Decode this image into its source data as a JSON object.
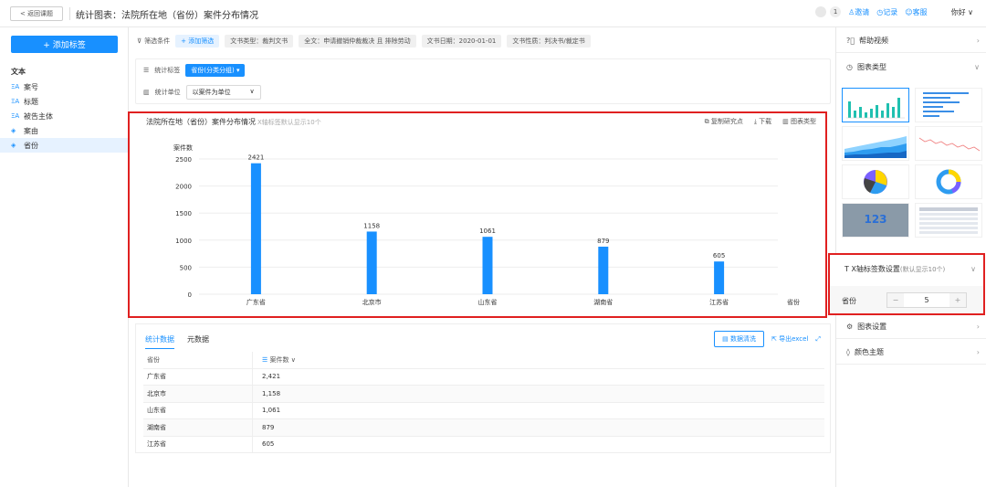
{
  "topbar": {
    "back_label": "< 返回课题",
    "title": "统计图表：法院所在地（省份）案件分布情况",
    "badge_count": "1",
    "invite": "邀请",
    "record": "记录",
    "service": "客服",
    "user": "你好 ∨"
  },
  "sidebar": {
    "add_tag": "+ 添加标签",
    "section": "文本",
    "items": [
      {
        "icon": "ΞA",
        "label": "案号"
      },
      {
        "icon": "ΞA",
        "label": "标题"
      },
      {
        "icon": "ΞA",
        "label": "被告主体"
      },
      {
        "icon": "◈",
        "label": "案由"
      },
      {
        "icon": "◈",
        "label": "省份"
      }
    ]
  },
  "filters": {
    "label": "筛选条件",
    "add": "+ 添加筛选",
    "chips": [
      "文书类型：裁判文书",
      "全文：申请撤销仲裁裁决 且 排除劳动",
      "文书日期：2020-01-01",
      "文书性质：判决书/裁定书"
    ]
  },
  "stat": {
    "tag_label": "统计标签",
    "tag_value": "省份(分类分组) ▾",
    "unit_label": "统计单位",
    "unit_value": "以案件为单位"
  },
  "chart": {
    "title": "法院所在地（省份）案件分布情况",
    "subtitle": "X轴标签默认显示10个",
    "tools": [
      "复制研究点",
      "下载",
      "图表类型"
    ]
  },
  "chart_data": {
    "type": "bar",
    "categories": [
      "广东省",
      "北京市",
      "山东省",
      "湖南省",
      "江苏省"
    ],
    "values": [
      2421,
      1158,
      1061,
      879,
      605
    ],
    "title": "法院所在地（省份）案件分布情况",
    "xlabel": "省份",
    "ylabel": "案件数",
    "ylim": [
      0,
      2500
    ],
    "yticks": [
      0,
      500,
      1000,
      1500,
      2000,
      2500
    ],
    "color": "#1890ff",
    "grid": true
  },
  "data_panel": {
    "tabs": [
      "统计数据",
      "元数据"
    ],
    "clean_btn": "数据清洗",
    "export": "导出excel",
    "col1": "省份",
    "col2": "案件数 ∨",
    "rows": [
      [
        "广东省",
        "2,421"
      ],
      [
        "北京市",
        "1,158"
      ],
      [
        "山东省",
        "1,061"
      ],
      [
        "湖南省",
        "879"
      ],
      [
        "江苏省",
        "605"
      ]
    ]
  },
  "right_panel": {
    "help": "帮助视频",
    "chart_type": "图表类型",
    "xlabel_title": "X轴标签数设置",
    "xlabel_hint": "(默认显示10个)",
    "xlabel_field": "省份",
    "xlabel_value": "5",
    "chart_settings": "图表设置",
    "color_theme": "颜色主题",
    "thumb_number": "123"
  }
}
